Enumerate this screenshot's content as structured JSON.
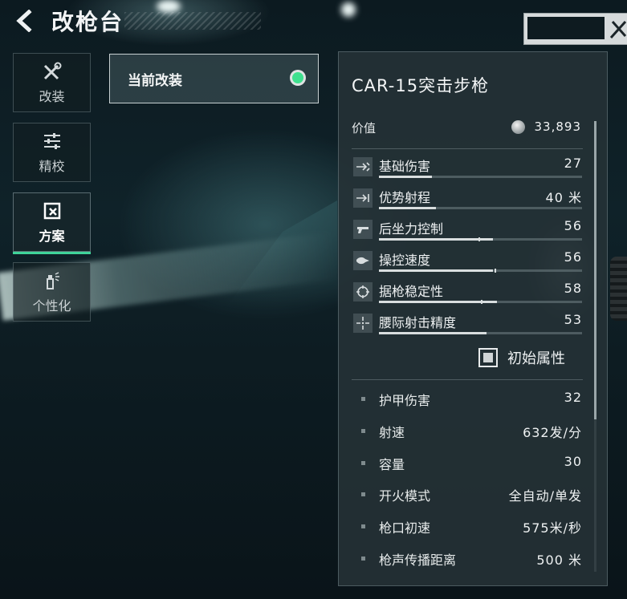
{
  "header": {
    "title": "改枪台",
    "back_icon": "back-arrow-icon"
  },
  "sidebar": {
    "items": [
      {
        "label": "改装",
        "icon": "wrench-screwdriver-icon",
        "active": false
      },
      {
        "label": "精校",
        "icon": "tune-sliders-icon",
        "active": false
      },
      {
        "label": "方案",
        "icon": "blueprint-icon",
        "active": true
      },
      {
        "label": "个性化",
        "icon": "spray-can-icon",
        "active": false
      }
    ]
  },
  "current_mod": {
    "label": "当前改装",
    "status_color": "#3fe08f"
  },
  "weapon": {
    "name": "CAR-15突击步枪",
    "value_label": "价值",
    "value": "33,893"
  },
  "stats": [
    {
      "label": "基础伤害",
      "value": "27",
      "icon": "damage-icon",
      "fraction": 0.26
    },
    {
      "label": "优势射程",
      "value": "40 米",
      "icon": "range-icon",
      "fraction": 0.28
    },
    {
      "label": "后坐力控制",
      "value": "56",
      "icon": "recoil-icon",
      "fraction": 0.56,
      "marker": 0.49
    },
    {
      "label": "操控速度",
      "value": "56",
      "icon": "handling-icon",
      "fraction": 0.56,
      "marker": 0.57
    },
    {
      "label": "据枪稳定性",
      "value": "58",
      "icon": "stability-crosshair-icon",
      "fraction": 0.58,
      "marker": 0.5
    },
    {
      "label": "腰际射击精度",
      "value": "53",
      "icon": "hipfire-crosshair-icon",
      "fraction": 0.53
    }
  ],
  "initial_toggle": {
    "label": "初始属性"
  },
  "details": [
    {
      "label": "护甲伤害",
      "value": "32"
    },
    {
      "label": "射速",
      "value": "632发/分"
    },
    {
      "label": "容量",
      "value": "30"
    },
    {
      "label": "开火模式",
      "value": "全自动/单发"
    },
    {
      "label": "枪口初速",
      "value": "575米/秒"
    },
    {
      "label": "枪声传播距离",
      "value": "500 米"
    }
  ],
  "colors": {
    "accent": "#3fd49a",
    "panel_bg": "#263237"
  }
}
